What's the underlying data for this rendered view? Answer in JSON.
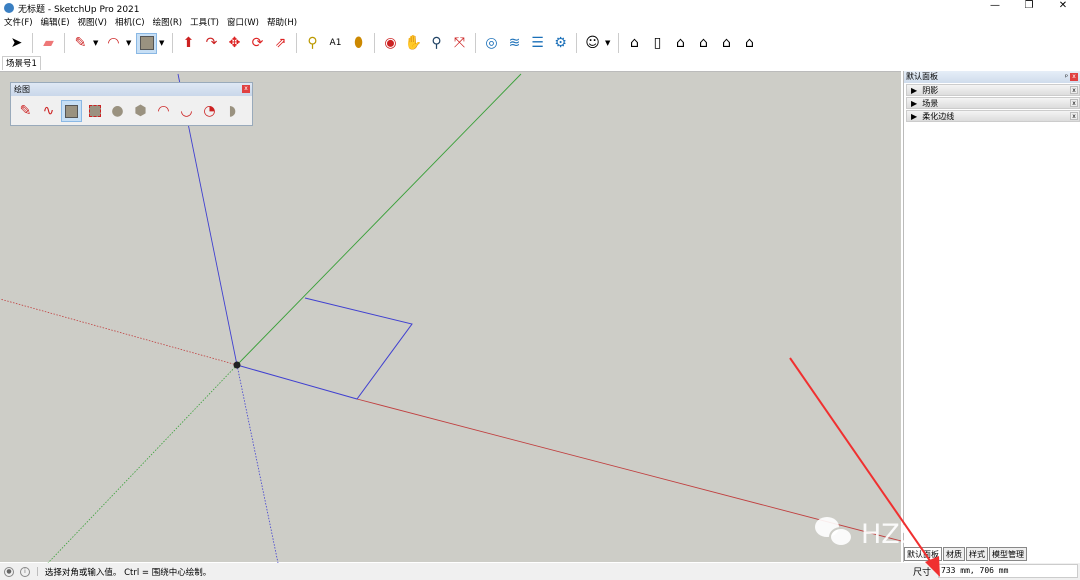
{
  "window": {
    "title": "无标题 - SketchUp Pro 2021",
    "min": "—",
    "max": "❐",
    "close": "✕"
  },
  "menu": [
    "文件(F)",
    "编辑(E)",
    "视图(V)",
    "相机(C)",
    "绘图(R)",
    "工具(T)",
    "窗口(W)",
    "帮助(H)"
  ],
  "scene_tab": "场景号1",
  "draw_panel": {
    "title": "绘图",
    "close": "x"
  },
  "tray": {
    "title": "默认面板",
    "pin": "ᵖ",
    "close": "x",
    "sections": [
      {
        "label": "阴影"
      },
      {
        "label": "场景"
      },
      {
        "label": "柔化边线"
      }
    ],
    "tabs": [
      "默认面板",
      "材质",
      "样式",
      "模型管理"
    ]
  },
  "status": {
    "message": "选择对角或输入值。 Ctrl = 围绕中心绘制。",
    "vcb_label": "尺寸",
    "vcb_value": "733 mm, 706 mm"
  },
  "watermark": "HZS设计研究所",
  "colors": {
    "canvas": "#cdcdc7",
    "red_axis": "#c04040",
    "green_axis": "#3aa03a",
    "blue_axis": "#4040d0",
    "arrow": "#f03030"
  }
}
